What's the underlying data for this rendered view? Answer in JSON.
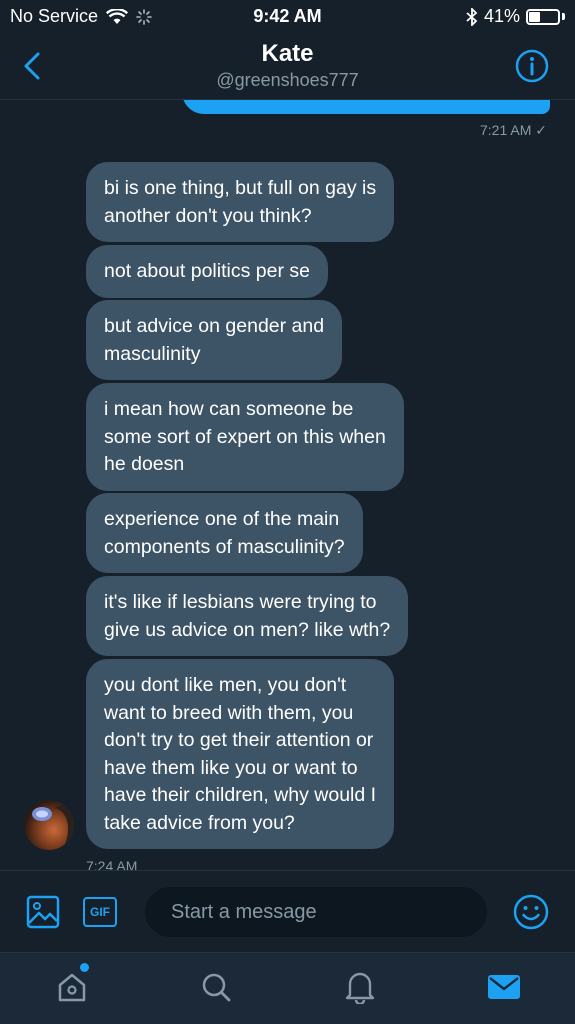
{
  "status": {
    "carrier": "No Service",
    "time": "9:42 AM",
    "battery_percent": "41%",
    "battery_level": 0.41
  },
  "header": {
    "name": "Kate",
    "handle": "@greenshoes777"
  },
  "sent": {
    "time": "7:21 AM ✓"
  },
  "messages": [
    "bi is one thing, but full on gay is\nanother don't you think?",
    "not about politics per se",
    "but advice on gender and\nmasculinity",
    "i mean how can someone be\nsome sort of expert on this when\nhe doesn",
    "experience one of the main\ncomponents of masculinity?",
    "it's like if lesbians were trying to\ngive us advice on men? like wth?",
    "you dont like men, you don't\nwant to breed with them, you\ndon't try to get their attention or\nhave them like you or want to\nhave their children, why would I\ntake advice from you?"
  ],
  "received": {
    "time": "7:24 AM"
  },
  "composer": {
    "gif_label": "GIF",
    "placeholder": "Start a message"
  },
  "colors": {
    "accent": "#1da1f2",
    "background": "#15202b",
    "bubble": "#3d5466",
    "muted": "#8899a6"
  },
  "tabs": [
    "home-icon",
    "search-icon",
    "notifications-icon",
    "messages-icon"
  ]
}
